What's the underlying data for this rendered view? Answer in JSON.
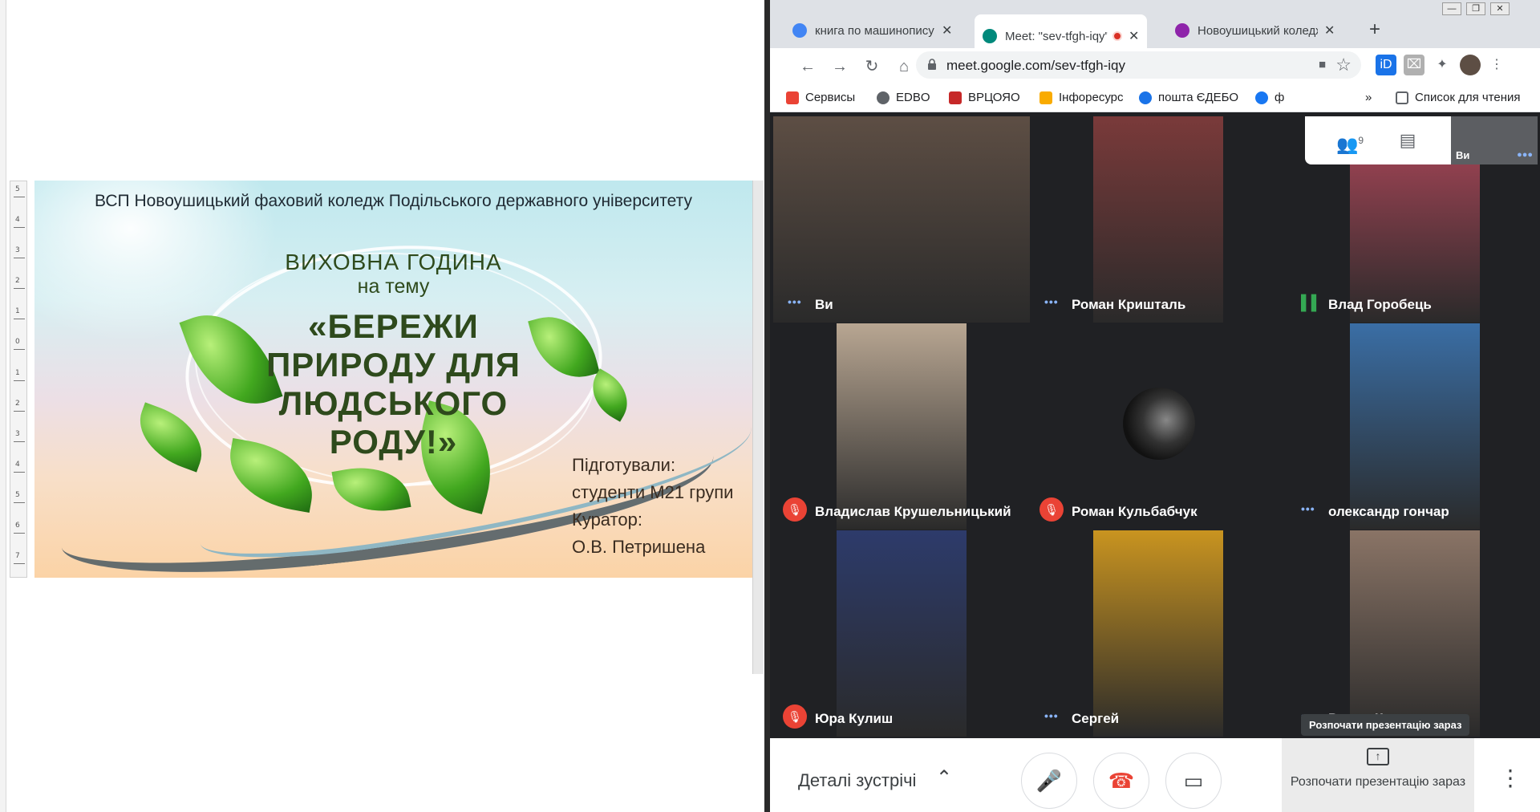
{
  "slide": {
    "institution": "ВСП Новоушицький фаховий коледж Подільського державного університету",
    "title_line1": "ВИХОВНА ГОДИНА",
    "title_line2": "на тему",
    "topic": "«БЕРЕЖИ ПРИРОДУ  ДЛЯ ЛЮДСЬКОГО РОДУ!»",
    "prepared_label": "Підготували:",
    "prepared_by": "студенти М21 групи",
    "curator_label": "Куратор:",
    "curator": "О.В. Петришена"
  },
  "ruler": {
    "labels": [
      "5",
      "4",
      "3",
      "2",
      "1",
      "0",
      "1",
      "2",
      "3",
      "4",
      "5",
      "6",
      "7"
    ]
  },
  "browser": {
    "window_controls": {
      "minimize": "—",
      "maximize": "❐",
      "close": "✕"
    },
    "tabs": [
      {
        "label": "книга по машинопису",
        "favicon_color": "#4285f4",
        "active": false
      },
      {
        "label": "Meet: \"sev-tfgh-iqy\"",
        "favicon_color": "#00897b",
        "active": true
      },
      {
        "label": "Новоушицький коледж",
        "favicon_color": "#8e24aa",
        "active": false
      }
    ],
    "new_tab": "+",
    "url": "meet.google.com/sev-tfgh-iqy",
    "bookmarks": [
      {
        "label": "Сервисы",
        "color": "#ea4335"
      },
      {
        "label": "EDBO",
        "color": "#5f6368"
      },
      {
        "label": "ВРЦОЯО",
        "color": "#c62828"
      },
      {
        "label": "Інфоресурс",
        "color": "#f9ab00"
      },
      {
        "label": "пошта ЄДЕБО",
        "color": "#1a73e8"
      },
      {
        "label": "ф",
        "color": "#1877f2"
      }
    ],
    "more_bookmarks": "»",
    "reading_list": "Список для чтения"
  },
  "meet": {
    "participants": [
      {
        "name": "Ви",
        "status": "dots",
        "bg": "#6d5a4e",
        "video_bg": "#5d4e44"
      },
      {
        "name": "Роман Кришталь",
        "status": "dots",
        "bg": "#202124",
        "video_bg": "#7a3a3a"
      },
      {
        "name": "Влад Горобець",
        "status": "speaking",
        "bg": "#202124",
        "video_bg": "#b0475a"
      },
      {
        "name": "Владислав Крушельницький",
        "status": "muted",
        "bg": "#202124",
        "video_bg": "#b8a692"
      },
      {
        "name": "Роман Кульбабчук",
        "status": "muted",
        "bg": "#202124",
        "video_bg": "#202124"
      },
      {
        "name": "олександр гончар",
        "status": "dots",
        "bg": "#202124",
        "video_bg": "#3a6ea5"
      },
      {
        "name": "Юра Кулиш",
        "status": "muted",
        "bg": "#202124",
        "video_bg": "#2d3b6b"
      },
      {
        "name": "Сергей",
        "status": "dots",
        "bg": "#202124",
        "video_bg": "#c99420"
      },
      {
        "name": "Роман Кошельник",
        "status": "dots",
        "bg": "#202124",
        "video_bg": "#8a7466"
      }
    ],
    "participants_count": "9",
    "self_label": "Ви",
    "tooltip": "Розпочати презентацію зараз",
    "details_label": "Деталі зустрічі",
    "present_label": "Розпочати презентацію зараз",
    "colors": {
      "muted": "#ea4335",
      "speaking": "#34a853",
      "dots": "#8ab4f8"
    }
  }
}
